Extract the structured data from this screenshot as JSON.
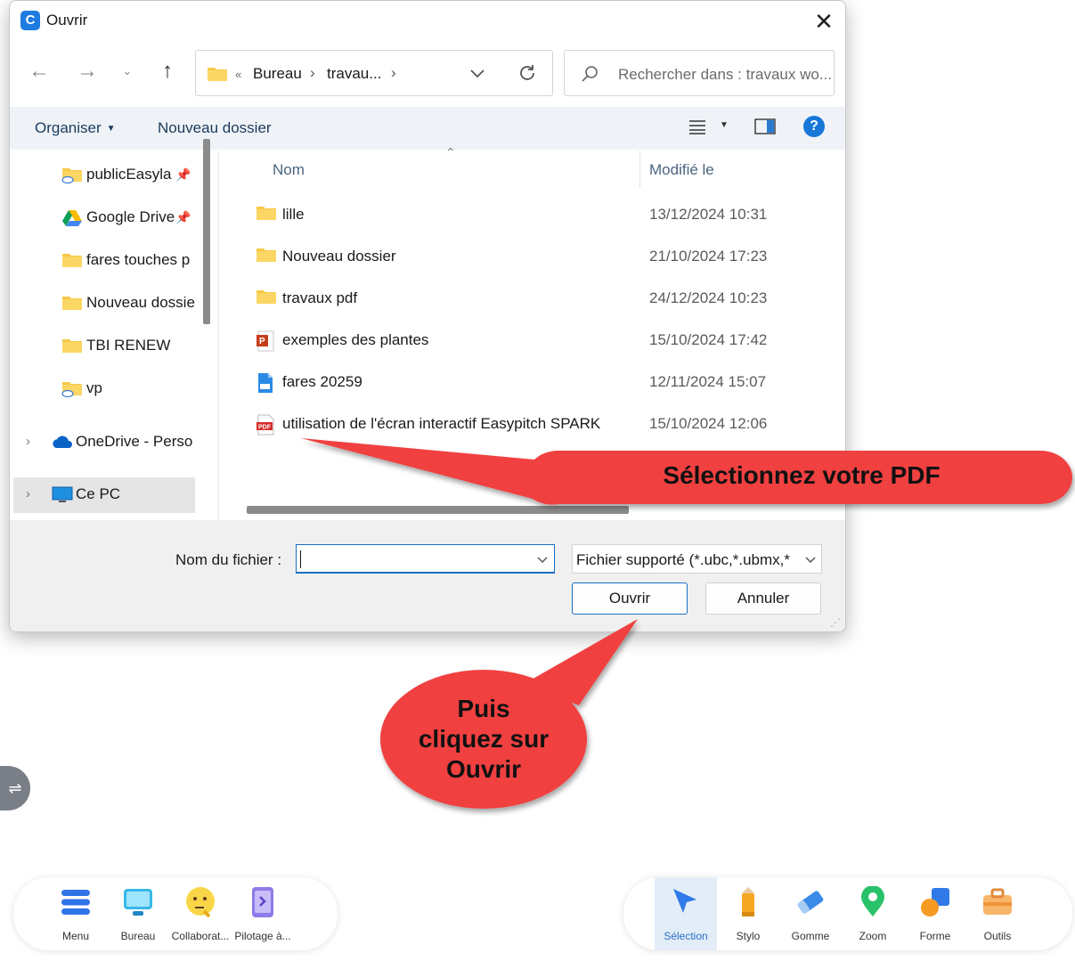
{
  "dialog": {
    "title": "Ouvrir",
    "address": {
      "prefix": "«",
      "crumbs": [
        "Bureau",
        "travau..."
      ]
    },
    "search_placeholder": "Rechercher dans : travaux wo...",
    "toolbar": {
      "organize": "Organiser",
      "new_folder": "Nouveau dossier"
    },
    "sidebar": [
      {
        "label": "publicEasyla",
        "icon": "cloud-folder-icon",
        "pinned": true
      },
      {
        "label": "Google Drive",
        "icon": "google-drive-icon",
        "pinned": true
      },
      {
        "label": "fares touches p",
        "icon": "folder-icon"
      },
      {
        "label": "Nouveau dossier",
        "icon": "folder-icon"
      },
      {
        "label": "TBI RENEW",
        "icon": "folder-icon"
      },
      {
        "label": "vp",
        "icon": "cloud-folder-icon"
      },
      {
        "label": "OneDrive - Perso",
        "icon": "onedrive-icon"
      },
      {
        "label": "Ce PC",
        "icon": "computer-icon"
      }
    ],
    "columns": {
      "name": "Nom",
      "modified": "Modifié le"
    },
    "files": [
      {
        "name": "lille",
        "date": "13/12/2024 10:31",
        "icon": "folder-icon"
      },
      {
        "name": "Nouveau dossier",
        "date": "21/10/2024 17:23",
        "icon": "folder-icon"
      },
      {
        "name": "travaux pdf",
        "date": "24/12/2024 10:23",
        "icon": "folder-icon"
      },
      {
        "name": "exemples des plantes",
        "date": "15/10/2024 17:42",
        "icon": "powerpoint-icon"
      },
      {
        "name": "fares 20259",
        "date": "12/11/2024 15:07",
        "icon": "ubc-file-icon"
      },
      {
        "name": "utilisation de  l'écran interactif Easypitch SPARK",
        "date": "15/10/2024 12:06",
        "icon": "pdf-icon"
      }
    ],
    "filename_label": "Nom du fichier :",
    "filename_value": "",
    "filetype": "Fichier supporté (*.ubc,*.ubmx,*",
    "open_button": "Ouvrir",
    "cancel_button": "Annuler"
  },
  "callouts": {
    "select_pdf": "Sélectionnez votre PDF",
    "click_open": [
      "Puis",
      "cliquez sur",
      "Ouvrir"
    ],
    "color": "#f04040"
  },
  "left_dock": [
    {
      "label": "Menu",
      "icon": "menu-icon"
    },
    {
      "label": "Bureau",
      "icon": "monitor-icon"
    },
    {
      "label": "Collaborat...",
      "icon": "thinking-face-icon"
    },
    {
      "label": "Pilotage à...",
      "icon": "tablet-control-icon"
    }
  ],
  "right_dock": [
    {
      "label": "Sélection",
      "icon": "cursor-icon",
      "active": true
    },
    {
      "label": "Stylo",
      "icon": "pencil-icon"
    },
    {
      "label": "Gomme",
      "icon": "eraser-icon"
    },
    {
      "label": "Zoom",
      "icon": "map-pin-icon"
    },
    {
      "label": "Forme",
      "icon": "shapes-icon"
    },
    {
      "label": "Outils",
      "icon": "toolbox-icon"
    }
  ],
  "colors": {
    "accent": "#1677d8",
    "toolbar_bg": "#eff3f7",
    "folder": "#f7c948"
  }
}
